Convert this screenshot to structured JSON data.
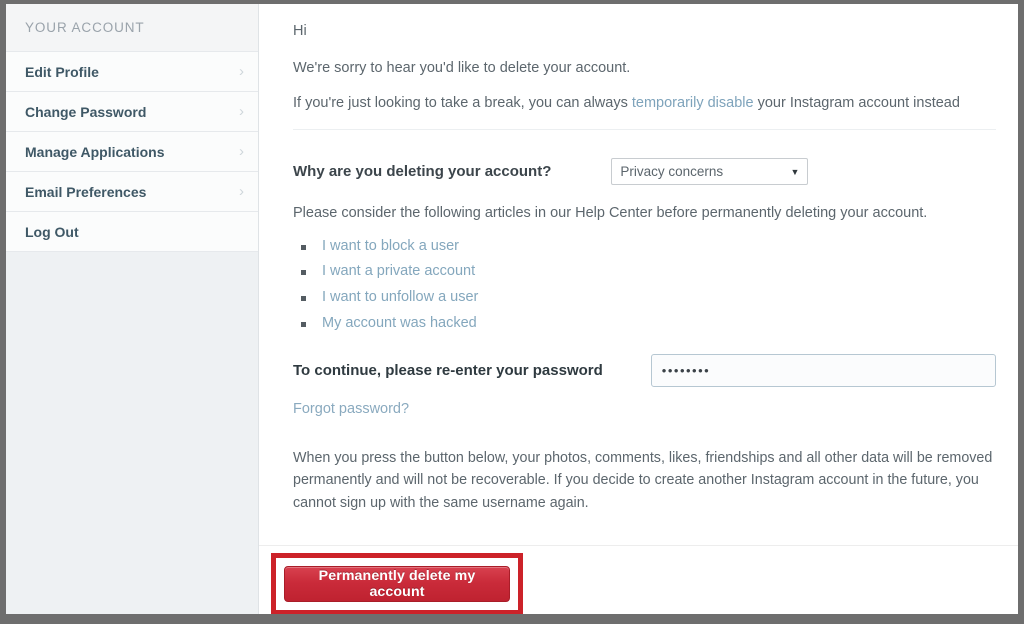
{
  "sidebar": {
    "header": "YOUR ACCOUNT",
    "items": [
      {
        "label": "Edit Profile",
        "chevron": "chevron-right-icon",
        "glyph": "›"
      },
      {
        "label": "Change Password",
        "chevron": "chevron-right-icon",
        "glyph": "›"
      },
      {
        "label": "Manage Applications",
        "chevron": "chevron-right-icon",
        "glyph": "›"
      },
      {
        "label": "Email Preferences",
        "chevron": "chevron-right-icon",
        "glyph": "›"
      },
      {
        "label": "Log Out",
        "chevron": "",
        "glyph": ""
      }
    ]
  },
  "main": {
    "greeting": "Hi",
    "sorry_line": "We're sorry to hear you'd like to delete your account.",
    "break_line_before": "If you're just looking to take a break, you can always ",
    "break_link": "temporarily disable",
    "break_line_after": " your Instagram account instead",
    "reason_label": "Why are you deleting your account?",
    "reason_selected": "Privacy concerns",
    "reason_options": [
      "Privacy concerns"
    ],
    "reason_caret": "▼",
    "consider_text": "Please consider the following articles in our Help Center before permanently deleting your account.",
    "help_articles": [
      "I want to block a user",
      "I want a private account",
      "I want to unfollow a user",
      "My account was hacked"
    ],
    "password_label": "To continue, please re-enter your password",
    "password_value": "••••••••",
    "password_placeholder": "",
    "forgot_password": "Forgot password?",
    "warning_text": "When you press the button below, your photos, comments, likes, friendships and all other data will be removed permanently and will not be recoverable. If you decide to create another Instagram account in the future, you cannot sign up with the same username again.",
    "delete_button": "Permanently delete my account"
  },
  "colors": {
    "highlight_box": "#cc2229",
    "delete_button": "#ca2b3a",
    "link": "#84a7bd",
    "sidebar_text": "#3f5866",
    "frame": "#6e6e6e"
  }
}
